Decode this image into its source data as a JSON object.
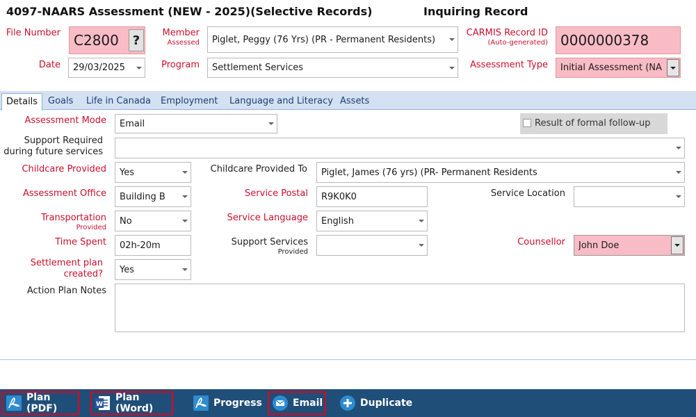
{
  "header": {
    "title": "4097-NAARS Assessment (NEW - 2025)(Selective Records)",
    "mode": "Inquiring Record"
  },
  "top": {
    "file_number_label": "File Number",
    "file_number": "C2800",
    "file_number_help": "?",
    "member_label": "Member",
    "member_sub": "Assessed",
    "member_value": "Piglet, Peggy (76 Yrs) (PR - Permanent Residents)",
    "carmis_label": "CARMIS Record ID",
    "carmis_sub": "(Auto-generated)",
    "carmis_value": "0000000378",
    "date_label": "Date",
    "date_value": "29/03/2025",
    "program_label": "Program",
    "program_value": "Settlement Services",
    "assessment_type_label": "Assessment Type",
    "assessment_type_value": "Initial Assessment (NA"
  },
  "tabs": [
    {
      "label": "Details"
    },
    {
      "label": "Goals"
    },
    {
      "label": "Life in Canada"
    },
    {
      "label": "Employment"
    },
    {
      "label": "Language and Literacy"
    },
    {
      "label": "Assets"
    }
  ],
  "details": {
    "assessment_mode_label": "Assessment Mode",
    "assessment_mode_value": "Email",
    "formal_followup_label": "Result of formal follow-up",
    "support_required_label1": "Support Required",
    "support_required_label2": "during future services",
    "support_required_value": "",
    "childcare_provided_label": "Childcare Provided",
    "childcare_provided_value": "Yes",
    "childcare_to_label": "Childcare Provided To",
    "childcare_to_value": "Piglet, James (76 yrs) (PR- Permanent Residents",
    "assessment_office_label": "Assessment Office",
    "assessment_office_value": "Building B",
    "service_postal_label": "Service Postal",
    "service_postal_value": "R9K0K0",
    "service_location_label": "Service Location",
    "service_location_value": "",
    "transportation_label": "Transportation",
    "transportation_sub": "Provided",
    "transportation_value": "No",
    "service_language_label": "Service Language",
    "service_language_value": "English",
    "time_spent_label": "Time Spent",
    "time_spent_value": "02h-20m",
    "support_services_label": "Support Services",
    "support_services_sub": "Provided",
    "support_services_value": "",
    "counsellor_label": "Counsellor",
    "counsellor_value": "John Doe",
    "settlement_plan_label1": "Settlement plan",
    "settlement_plan_label2": "created?",
    "settlement_plan_value": "Yes",
    "action_plan_label": "Action Plan Notes",
    "action_plan_value": ""
  },
  "footer": {
    "plan_pdf": "Plan (PDF)",
    "plan_word": "Plan (Word)",
    "progress": "Progress",
    "email": "Email",
    "duplicate": "Duplicate"
  },
  "colors": {
    "required_label": "#c8102e",
    "highlight_field": "#f9bcc6",
    "tab_bar": "#d3e1f2",
    "footer_bar": "#1f4e78",
    "button_highlight": "#e6001a"
  }
}
